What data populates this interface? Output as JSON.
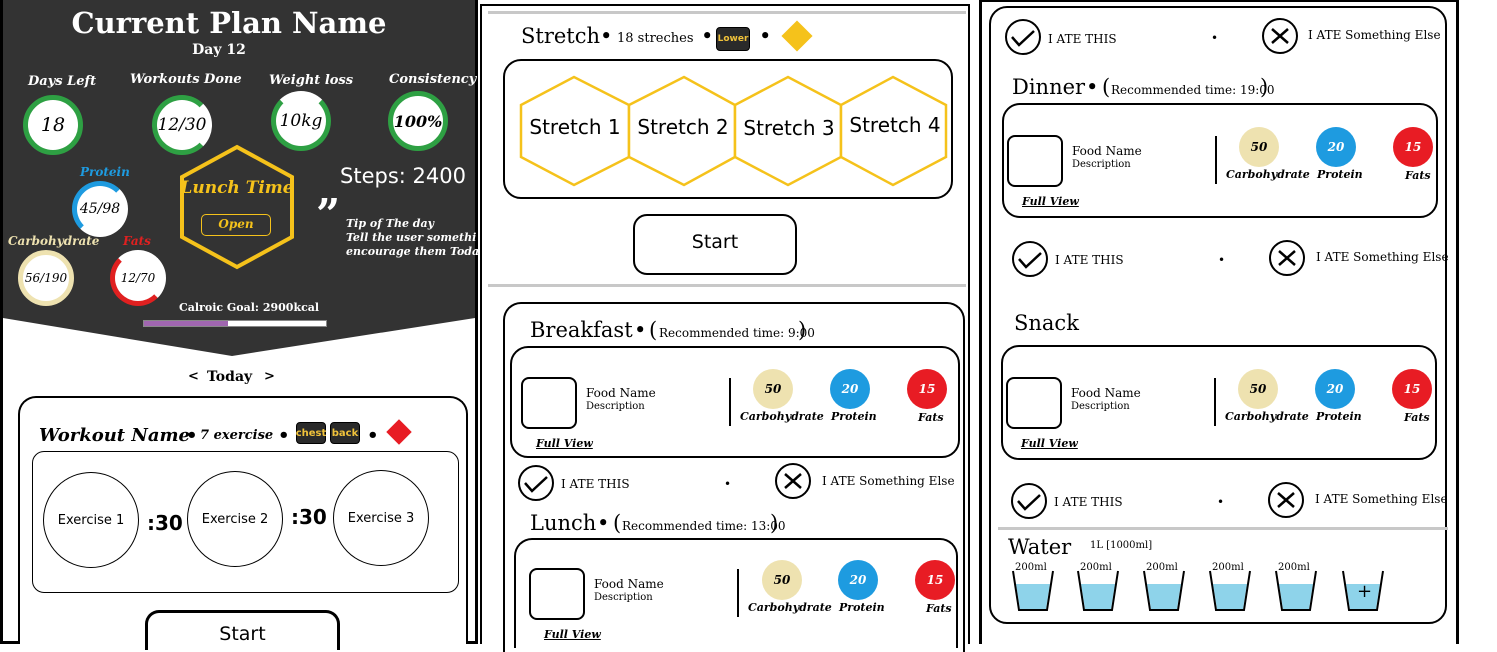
{
  "plan": {
    "title": "Current Plan Name",
    "day": "Day 12",
    "stats": [
      {
        "label": "Days Left",
        "value": "18",
        "color": "#2ea043"
      },
      {
        "label": "Workouts Done",
        "value": "12/30",
        "color": "#2ea043"
      },
      {
        "label": "Weight loss",
        "value": "10kg",
        "color": "#2ea043"
      },
      {
        "label": "Consistency",
        "value": "100%",
        "color": "#2ea043"
      }
    ],
    "macros_rings": [
      {
        "label": "Protein",
        "value": "45/98",
        "color": "#1e9be0"
      },
      {
        "label": "Carbohydrate",
        "value": "56/190",
        "color": "#eee2b0"
      },
      {
        "label": "Fats",
        "value": "12/70",
        "color": "#e02020"
      }
    ],
    "lunch": {
      "title": "Lunch Time",
      "button": "Open"
    },
    "steps": "Steps: 2400",
    "tip": {
      "quote": "”",
      "title": "Tip of The day",
      "line1": "Tell the user something to",
      "line2": "encourage them Today"
    },
    "calorie_goal": "Calroic Goal: 2900kcal",
    "calorie_progress": 0.46,
    "colors": {
      "hero_bg": "#333333",
      "accent": "#f5c21b",
      "purple": "#a066b0"
    }
  },
  "nav": {
    "prev": "<",
    "label": "Today",
    "next": ">"
  },
  "workout": {
    "name": "Workout Name",
    "bullet": "•",
    "count": "7 exercise",
    "tags": [
      "chest",
      "back"
    ],
    "exercises": [
      "Exercise 1",
      "Exercise 2",
      "Exercise 3"
    ],
    "rests": [
      ":30",
      ":30"
    ],
    "start": "Start"
  },
  "stretch": {
    "title": "Stretch",
    "count": "18 streches",
    "tag": "Lower",
    "items": [
      "Stretch 1",
      "Stretch 2",
      "Stretch 3",
      "Stretch 4"
    ],
    "start": "Start"
  },
  "meals": {
    "breakfast": {
      "title": "Breakfast",
      "recommended": "Recommended time: 9:00"
    },
    "lunch": {
      "title": "Lunch",
      "recommended": "Recommended time: 13:00"
    },
    "dinner": {
      "title": "Dinner",
      "recommended": "Recommended time: 19:00"
    },
    "snack": {
      "title": "Snack"
    },
    "food_name": "Food Name",
    "description": "Description",
    "full_view": "Full View",
    "carbs_value": "50",
    "protein_value": "20",
    "fats_value": "15",
    "carbs_label": "Carbohydrate",
    "protein_label": "Protein",
    "fats_label": "Fats",
    "ate_this": "I ATE THIS",
    "ate_else": "I ATE Something Else",
    "sep": "•",
    "colors": {
      "carbs": "#eee2b0",
      "protein": "#1e9be0",
      "fats": "#e81c24"
    }
  },
  "water": {
    "title": "Water",
    "goal": "1L  [1000ml]",
    "cups": [
      "200ml",
      "200ml",
      "200ml",
      "200ml",
      "200ml"
    ],
    "add": "+",
    "color": "#8ed3ea"
  }
}
